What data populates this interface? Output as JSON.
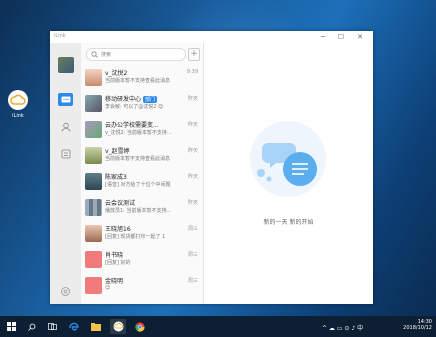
{
  "desktop": {
    "shortcut_label": "iLink"
  },
  "window": {
    "title": "iLink",
    "controls": {
      "minimize": "─",
      "maximize": "☐",
      "close": "✕"
    },
    "search_placeholder": "搜索",
    "add_label": "+",
    "conversations": [
      {
        "name": "v_沈悦2",
        "preview": "当前版本暂不支持查看此消息",
        "time": "9:39",
        "avatar": "photo"
      },
      {
        "name": "移动研发中心",
        "badge": "部门",
        "preview": "李会敏: 可以了@沈悦2 😊",
        "time": "昨天",
        "avatar": "team"
      },
      {
        "name": "云办公学校需要变...",
        "preview": "v_沈悦2: 当前版本暂不支持...",
        "time": "昨天",
        "avatar": "photo2"
      },
      {
        "name": "v_赵雪婷",
        "preview": "当前版本暂不支持查看此消息",
        "time": "昨天",
        "avatar": "photo3"
      },
      {
        "name": "陈家成3",
        "preview": "[语音] 对方给了十位个中间题",
        "time": "昨天",
        "avatar": "photo4"
      },
      {
        "name": "云会议测试",
        "preview": "播放员1: 当前版本暂不支持...",
        "time": "昨天",
        "avatar": "grid"
      },
      {
        "name": "王晓旭16",
        "preview": "[回复] 现货都打印一起了 1",
        "time": "周三",
        "avatar": "photo5"
      },
      {
        "name": "肖书晓",
        "preview": "[回复] 好的",
        "time": "周三",
        "avatar": "red"
      },
      {
        "name": "金晓明",
        "preview": "😊",
        "time": "周三",
        "avatar": "red"
      }
    ],
    "welcome_text": "新的一天 新的开始"
  },
  "taskbar": {
    "time": "14:30",
    "date": "2018/10/12",
    "tray_icons": "^ ☁ ▭ ⊙ ♪ 中"
  },
  "colors": {
    "accent": "#2b8ae8",
    "taskbar": "#0c1f33",
    "desktop": "#1a5fa0"
  }
}
